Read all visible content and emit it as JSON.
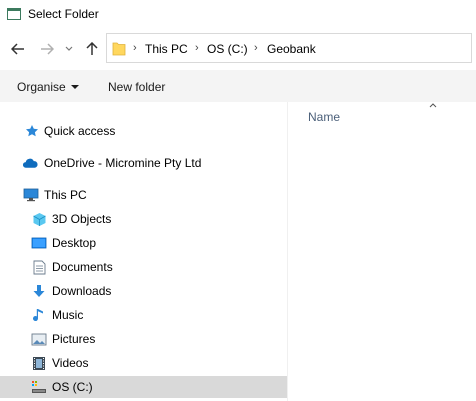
{
  "window": {
    "title": "Select Folder",
    "icon": "folder-window-icon"
  },
  "navigation": {
    "back_icon": "arrow-left-icon",
    "forward_icon": "arrow-right-icon",
    "recent_icon": "chevron-down-icon",
    "up_icon": "arrow-up-icon"
  },
  "address": {
    "separator": "›",
    "crumbs": [
      "This PC",
      "OS (C:)",
      "Geobank"
    ]
  },
  "toolbar": {
    "organise_label": "Organise",
    "new_folder_label": "New folder"
  },
  "tree": {
    "items": [
      {
        "label": "Quick access",
        "icon": "star-icon"
      },
      {
        "label": "OneDrive - Micromine Pty Ltd",
        "icon": "cloud-icon"
      },
      {
        "label": "This PC",
        "icon": "computer-icon"
      },
      {
        "label": "3D Objects",
        "icon": "cube-icon"
      },
      {
        "label": "Desktop",
        "icon": "desktop-icon"
      },
      {
        "label": "Documents",
        "icon": "document-icon"
      },
      {
        "label": "Downloads",
        "icon": "download-icon"
      },
      {
        "label": "Music",
        "icon": "music-note-icon"
      },
      {
        "label": "Pictures",
        "icon": "picture-icon"
      },
      {
        "label": "Videos",
        "icon": "film-icon"
      },
      {
        "label": "OS (C:)",
        "icon": "drive-icon"
      }
    ],
    "selected_label": "OS (C:)"
  },
  "content": {
    "column_name": "Name"
  },
  "colors": {
    "accent": "#0078d7",
    "toolbar_bg": "#f4f4f4",
    "selected_bg": "#d9d9d9",
    "folder_yellow": "#ffd75e"
  }
}
